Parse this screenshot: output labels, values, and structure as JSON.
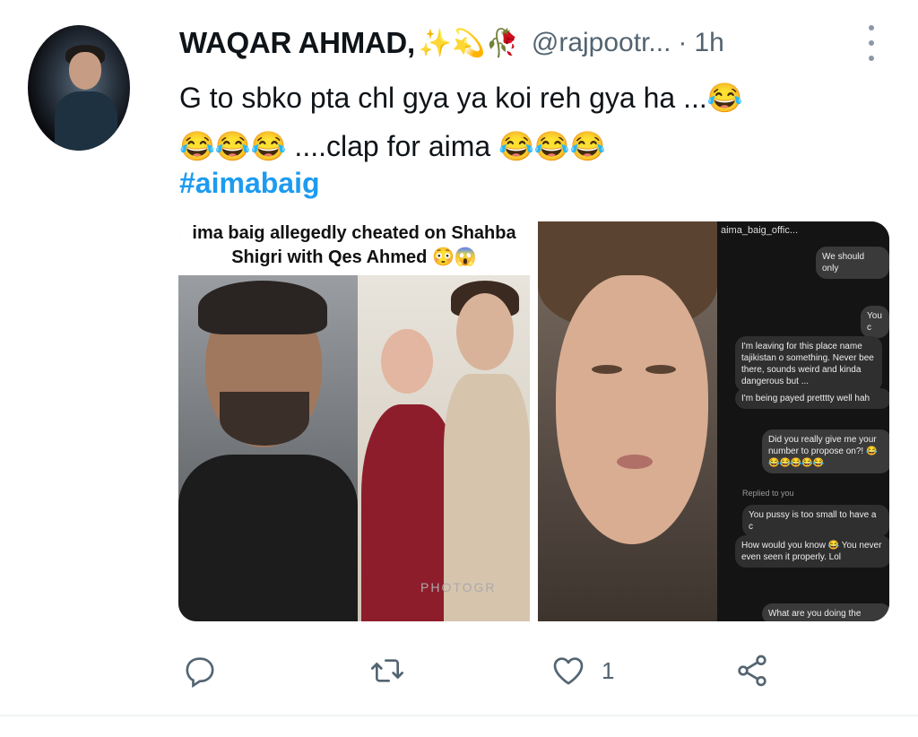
{
  "tweet": {
    "author_name": "WAQAR AHMAD,",
    "author_emojis": "✨💫🥀",
    "handle": "@rajpootr...",
    "separator": "·",
    "time": "1h",
    "text_line1": "G to sbko pta chl gya ya koi reh gya ha ...😂",
    "text_line2": "😂😂😂 ....clap for aima 😂😂😂",
    "hashtag": "#aimabaig"
  },
  "media": {
    "left_caption_line1": "ima baig allegedly cheated on Shahba",
    "left_caption_line2": "Shigri with Qes Ahmed 😳😱",
    "left_watermark": "PHOTOGR",
    "chat_header": "aima_baig_offic...",
    "chat_messages": [
      "We should only",
      "You c",
      "I'm leaving for this place name tajikistan o something. Never bee there, sounds weird and kinda dangerous but ...",
      "I'm being payed pretttty well hah",
      "Did you really give me your number to propose on?! 😂😂😂😂😂😂",
      "Replied to you",
      "You pussy is too small to have a c",
      "How would you know 😂 You never even seen it properly. Lol",
      "What are you doing the"
    ]
  },
  "actions": {
    "reply_icon": "reply-icon",
    "retweet_icon": "retweet-icon",
    "like_icon": "heart-icon",
    "like_count": "1",
    "share_icon": "share-icon"
  }
}
